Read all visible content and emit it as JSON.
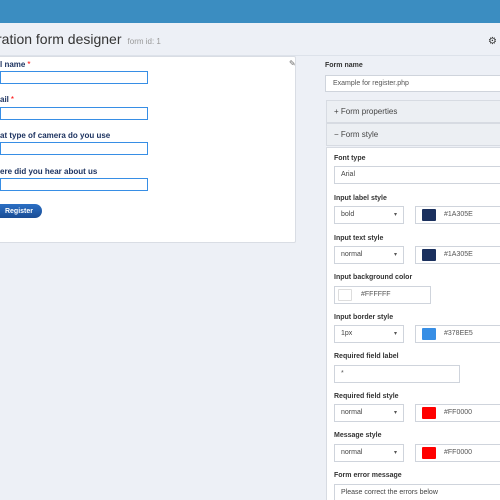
{
  "header": {
    "title": "ration form designer",
    "form_id": "form id: 1"
  },
  "preview": {
    "fields": [
      {
        "label": "l name",
        "required_mark": "*"
      },
      {
        "label": "ail",
        "required_mark": "*"
      },
      {
        "label": "at type of camera do you use",
        "required_mark": ""
      },
      {
        "label": "ere did you hear about us",
        "required_mark": ""
      }
    ],
    "submit_label": "Register"
  },
  "settings": {
    "form_name_label": "Form name",
    "form_name_value": "Example for register.php",
    "form_properties_label": "Form properties",
    "form_style_label": "Form style",
    "font_type_label": "Font type",
    "font_type_value": "Arial",
    "input_label_style": {
      "label": "Input label style",
      "value": "bold",
      "color": "#1A305E"
    },
    "input_text_style": {
      "label": "Input text style",
      "value": "normal",
      "color": "#1A305E"
    },
    "input_background": {
      "label": "Input background color",
      "color": "#FFFFFF"
    },
    "input_border_style": {
      "label": "Input border style",
      "value": "1px",
      "color": "#378EE5"
    },
    "required_field_label": {
      "label": "Required field label",
      "value": "*"
    },
    "required_field_style": {
      "label": "Required field style",
      "value": "normal",
      "color": "#FF0000"
    },
    "message_style": {
      "label": "Message style",
      "value": "normal",
      "color": "#FF0000"
    },
    "form_error_message": {
      "label": "Form error message",
      "value": "Please correct the errors below"
    }
  },
  "icons": {
    "plus": "+",
    "minus": "−",
    "caret": "▾",
    "gear": "⚙",
    "pin": "✎"
  },
  "colors": {
    "topbar": "#3B8DC1",
    "label_color": "#1A305E",
    "border_color": "#378EE5",
    "required_color": "#FF0000"
  }
}
